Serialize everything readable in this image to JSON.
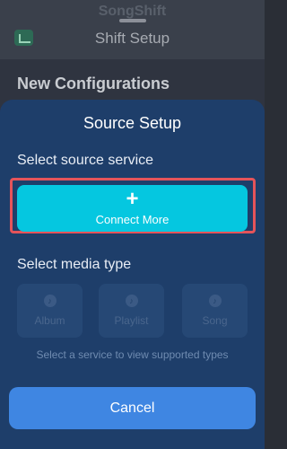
{
  "background": {
    "brand": "SongShift",
    "title": "Shift Setup",
    "heading": "New Configurations"
  },
  "sheet": {
    "title": "Source Setup",
    "source_label": "Select source service",
    "connect_button": {
      "icon": "+",
      "label": "Connect More"
    },
    "media_label": "Select media type",
    "media_types": [
      {
        "label": "Album",
        "icon": "album-icon"
      },
      {
        "label": "Playlist",
        "icon": "playlist-icon"
      },
      {
        "label": "Song",
        "icon": "song-icon"
      }
    ],
    "hint": "Select a service to view supported types",
    "cancel_label": "Cancel"
  },
  "colors": {
    "sheet_bg": "#1e3e6a",
    "connect_button": "#05c7e0",
    "cancel_button": "#3f86e2",
    "highlight": "#e5545a"
  }
}
